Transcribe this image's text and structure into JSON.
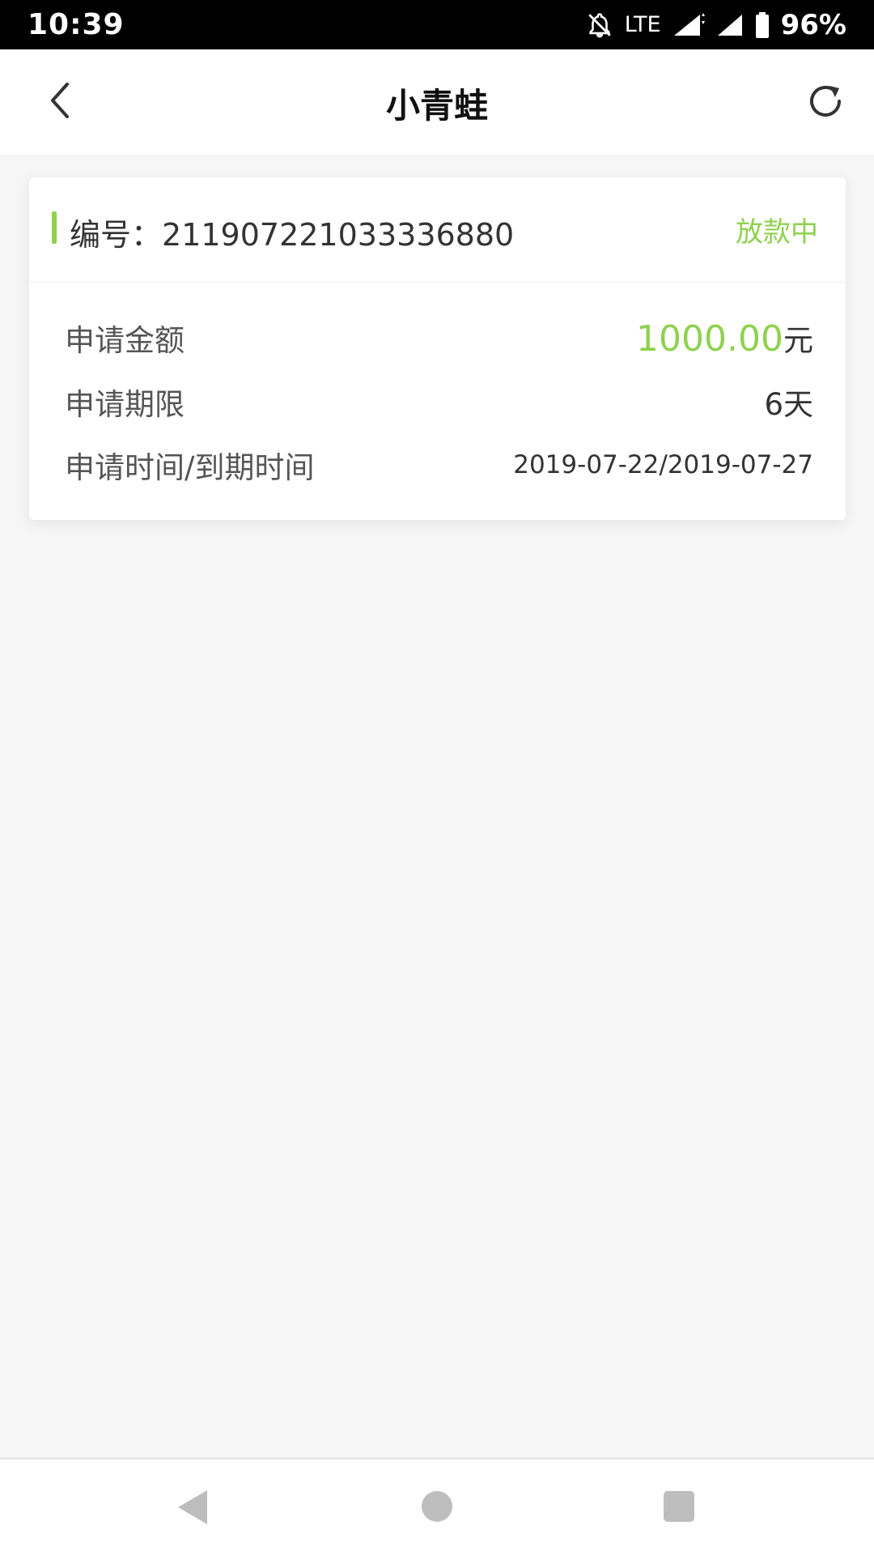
{
  "status_bar": {
    "time": "10:39",
    "network": "LTE",
    "battery": "96%",
    "icons": [
      "bell-off-icon",
      "signal-icon",
      "signal-icon",
      "battery-icon"
    ]
  },
  "header": {
    "title": "小青蛙",
    "back_icon": "chevron-left-icon",
    "refresh_icon": "refresh-icon"
  },
  "order": {
    "number_label": "编号：",
    "number": "211907221033336880",
    "status": "放款中",
    "rows": [
      {
        "label": "申请金额",
        "value": "1000.00",
        "unit": "元"
      },
      {
        "label": "申请期限",
        "value": "6天"
      },
      {
        "label": "申请时间/到期时间",
        "value": "2019-07-22/2019-07-27"
      }
    ]
  },
  "colors": {
    "accent": "#8fd14f",
    "background": "#f6f6f6",
    "card": "#ffffff",
    "text_primary": "#333333",
    "text_secondary": "#555555"
  },
  "nav_bar": {
    "icons": [
      "back-triangle-icon",
      "home-circle-icon",
      "recents-square-icon"
    ]
  }
}
